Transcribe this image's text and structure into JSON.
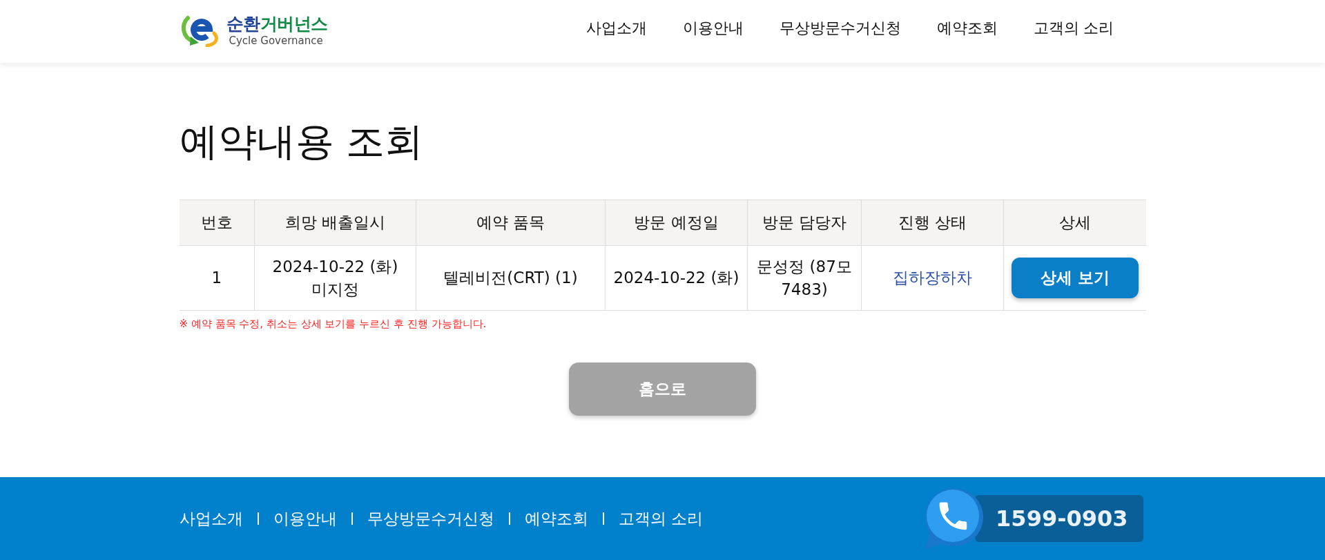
{
  "header": {
    "logo": {
      "title_segments": [
        {
          "text": "순환",
          "color": "#1f4396"
        },
        {
          "text": "거버넌스",
          "color": "#0f8a45"
        }
      ],
      "subtitle": "Cycle Governance"
    },
    "nav": [
      "사업소개",
      "이용안내",
      "무상방문수거신청",
      "예약조회",
      "고객의 소리"
    ]
  },
  "page_title": "예약내용 조회",
  "table": {
    "columns": [
      "번호",
      "희망 배출일시",
      "예약 품목",
      "방문 예정일",
      "방문 담당자",
      "진행 상태",
      "상세"
    ],
    "rows": [
      {
        "number": "1",
        "desired_datetime": "2024-10-22 (화) 미지정",
        "item": "텔레비전(CRT) (1)",
        "visit_date": "2024-10-22 (화)",
        "staff": "문성정 (87모 7483)",
        "status": "집하장하차",
        "detail_button": "상세 보기"
      }
    ]
  },
  "notice": "※ 예약 품목 수정, 취소는 상세 보기를 누르신 후 진행 가능합니다.",
  "home_button": "홈으로",
  "footer": {
    "links": [
      "사업소개",
      "이용안내",
      "무상방문수거신청",
      "예약조회",
      "고객의 소리"
    ],
    "phone": "1599-0903"
  }
}
